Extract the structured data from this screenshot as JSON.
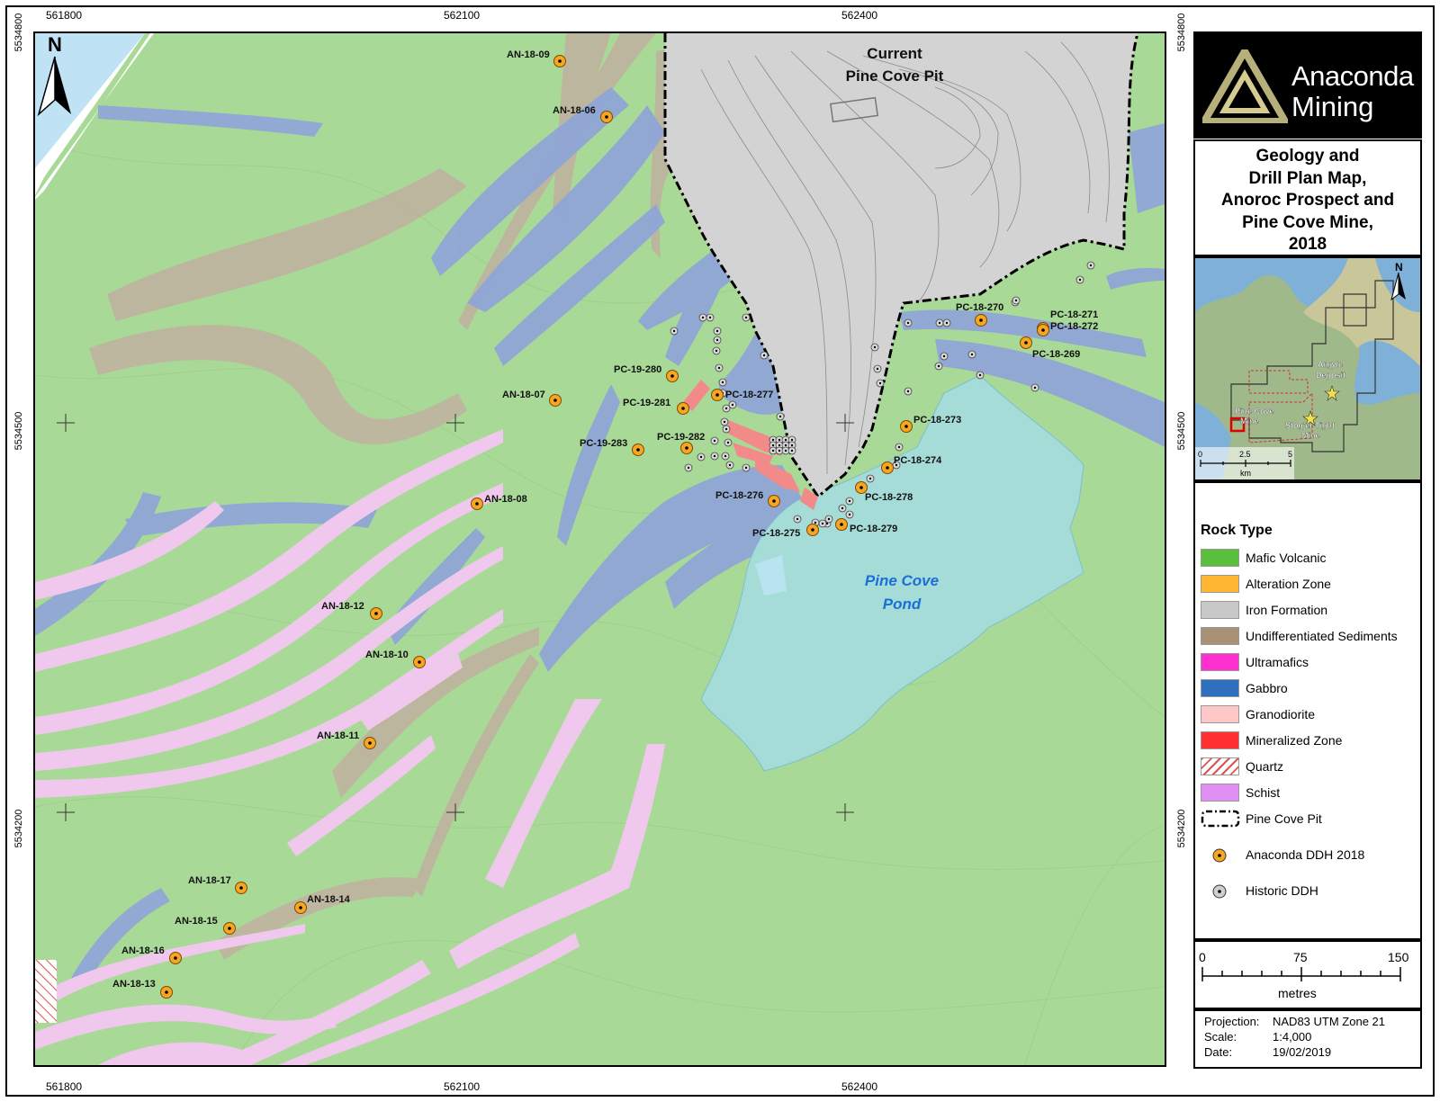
{
  "coords": {
    "easting": [
      "561800",
      "562100",
      "562400"
    ],
    "northing": [
      "5534800",
      "5534500",
      "5534200"
    ]
  },
  "map": {
    "north": "N",
    "pit_label_line1": "Current",
    "pit_label_line2": "Pine Cove Pit",
    "pond_label_line1": "Pine Cove",
    "pond_label_line2": "Pond",
    "anaconda_holes": [
      {
        "label": "AN-18-09"
      },
      {
        "label": "AN-18-06"
      },
      {
        "label": "AN-18-07"
      },
      {
        "label": "AN-18-08"
      },
      {
        "label": "AN-18-12"
      },
      {
        "label": "AN-18-10"
      },
      {
        "label": "AN-18-11"
      },
      {
        "label": "AN-18-17"
      },
      {
        "label": "AN-18-14"
      },
      {
        "label": "AN-18-15"
      },
      {
        "label": "AN-18-16"
      },
      {
        "label": "AN-18-13"
      },
      {
        "label": "PC-19-280"
      },
      {
        "label": "PC-19-281"
      },
      {
        "label": "PC-18-277"
      },
      {
        "label": "PC-19-283"
      },
      {
        "label": "PC-19-282"
      },
      {
        "label": "PC-18-276"
      },
      {
        "label": "PC-18-275"
      },
      {
        "label": "PC-18-279"
      },
      {
        "label": "PC-18-278"
      },
      {
        "label": "PC-18-274"
      },
      {
        "label": "PC-18-273"
      },
      {
        "label": "PC-18-270"
      },
      {
        "label": "PC-18-271"
      },
      {
        "label": "PC-18-272"
      },
      {
        "label": "PC-18-269"
      }
    ]
  },
  "logo": {
    "line1": "Anaconda",
    "line2": "Mining"
  },
  "title": {
    "line1": "Geology and",
    "line2": "Drill Plan Map,",
    "line3": "Anoroc Prospect and",
    "line4": "Pine Cove Mine,",
    "line5": "2018"
  },
  "inset": {
    "north": "N",
    "argyle": "Argyle",
    "deposit": "Deposit",
    "pine_cove": "Pine Cove",
    "mine": "Mine",
    "stog_tight": "Stog'er Tight",
    "stog_mine": "Mine",
    "scale": [
      "0",
      "2.5",
      "5"
    ],
    "unit": "km"
  },
  "legend": {
    "title": "Rock Type",
    "items": [
      {
        "label": "Mafic Volcanic",
        "color": "#5bbf3e"
      },
      {
        "label": "Alteration Zone",
        "color": "#ffb733"
      },
      {
        "label": "Iron Formation",
        "color": "#c8c8c8"
      },
      {
        "label": "Undifferentiated Sediments",
        "color": "#a89277"
      },
      {
        "label": "Ultramafics",
        "color": "#ff2fd0"
      },
      {
        "label": "Gabbro",
        "color": "#2f6fbf"
      },
      {
        "label": "Granodiorite",
        "color": "#ffc8c8"
      },
      {
        "label": "Mineralized Zone",
        "color": "#ff3030"
      },
      {
        "label": "Quartz",
        "color": "hatch"
      },
      {
        "label": "Schist",
        "color": "#e08ff2"
      }
    ],
    "pit": "Pine Cove Pit",
    "anaconda_ddh": "Anaconda DDH 2018",
    "historic_ddh": "Historic DDH"
  },
  "scalebar": {
    "ticks": [
      "0",
      "75",
      "150"
    ],
    "unit": "metres"
  },
  "info": {
    "projection_label": "Projection:",
    "projection": "NAD83 UTM Zone 21",
    "scale_label": "Scale:",
    "scale": "1:4,000",
    "date_label": "Date:",
    "date": "19/02/2019"
  }
}
